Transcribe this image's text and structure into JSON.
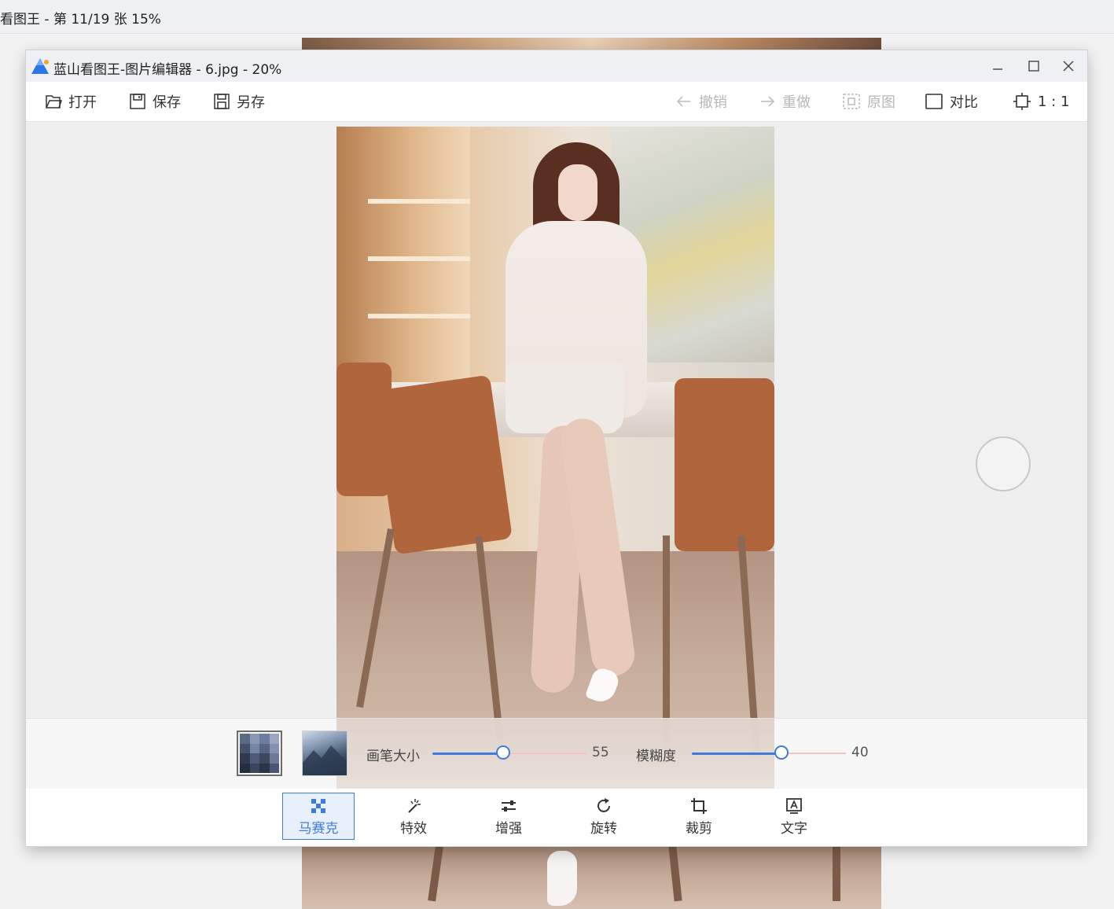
{
  "background_window": {
    "title": "看图王 - 第 11/19 张 15%"
  },
  "editor": {
    "title": "蓝山看图王-图片编辑器 - 6.jpg - 20%",
    "window_controls": {
      "minimize_icon": "minimize-icon",
      "maximize_icon": "maximize-icon",
      "close_icon": "close-icon"
    },
    "toolbar": {
      "open_label": "打开",
      "save_label": "保存",
      "save_as_label": "另存",
      "undo_label": "撤销",
      "redo_label": "重做",
      "original_label": "原图",
      "compare_label": "对比",
      "actual_size_label": "1 : 1"
    },
    "mosaic_options": {
      "brush_size_label": "画笔大小",
      "brush_size_value": "55",
      "brush_size_fraction": 0.46,
      "blur_label": "模糊度",
      "blur_value": "40",
      "blur_fraction": 0.58
    },
    "tools": [
      {
        "label": "马赛克",
        "icon": "mosaic-icon",
        "active": true
      },
      {
        "label": "特效",
        "icon": "magic-wand-icon",
        "active": false
      },
      {
        "label": "增强",
        "icon": "sliders-icon",
        "active": false
      },
      {
        "label": "旋转",
        "icon": "rotate-icon",
        "active": false
      },
      {
        "label": "裁剪",
        "icon": "crop-icon",
        "active": false
      },
      {
        "label": "文字",
        "icon": "text-icon",
        "active": false
      }
    ],
    "colors": {
      "accent": "#3f7bd9",
      "slider_rest": "#f2c4c4"
    }
  }
}
